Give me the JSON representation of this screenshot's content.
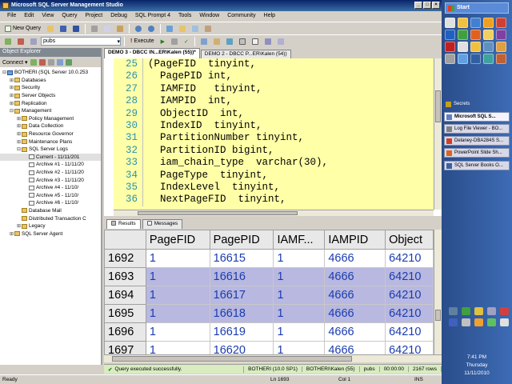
{
  "window": {
    "title": "Microsoft SQL Server Management Studio"
  },
  "menu": [
    "File",
    "Edit",
    "View",
    "Query",
    "Project",
    "Debug",
    "SQL Prompt 4",
    "Tools",
    "Window",
    "Community",
    "Help"
  ],
  "toolbar": {
    "new_query": "New Query",
    "database": "pubs",
    "execute": "Execute"
  },
  "object_explorer": {
    "title": "Object Explorer",
    "connect": "Connect ▾",
    "nodes": [
      {
        "label": "BOTHERI (SQL Server 10.0.253",
        "level": 0,
        "exp": "⊟",
        "kind": "srv"
      },
      {
        "label": "Databases",
        "level": 1,
        "exp": "⊞",
        "kind": "folder"
      },
      {
        "label": "Security",
        "level": 1,
        "exp": "⊞",
        "kind": "folder"
      },
      {
        "label": "Server Objects",
        "level": 1,
        "exp": "⊞",
        "kind": "folder"
      },
      {
        "label": "Replication",
        "level": 1,
        "exp": "⊞",
        "kind": "folder"
      },
      {
        "label": "Management",
        "level": 1,
        "exp": "⊟",
        "kind": "folder"
      },
      {
        "label": "Policy Management",
        "level": 2,
        "exp": "⊞",
        "kind": "folder"
      },
      {
        "label": "Data Collection",
        "level": 2,
        "exp": "⊞",
        "kind": "folder"
      },
      {
        "label": "Resource Governor",
        "level": 2,
        "exp": "⊞",
        "kind": "folder"
      },
      {
        "label": "Maintenance Plans",
        "level": 2,
        "exp": "⊞",
        "kind": "folder"
      },
      {
        "label": "SQL Server Logs",
        "level": 2,
        "exp": "⊟",
        "kind": "folder"
      },
      {
        "label": "Current - 11/11/201",
        "level": 3,
        "exp": "",
        "kind": "log",
        "selected": true
      },
      {
        "label": "Archive #1 - 11/11/20",
        "level": 3,
        "exp": "",
        "kind": "log"
      },
      {
        "label": "Archive #2 - 11/11/20",
        "level": 3,
        "exp": "",
        "kind": "log"
      },
      {
        "label": "Archive #3 - 11/11/20",
        "level": 3,
        "exp": "",
        "kind": "log"
      },
      {
        "label": "Archive #4 - 11/10/",
        "level": 3,
        "exp": "",
        "kind": "log"
      },
      {
        "label": "Archive #5 - 11/10/",
        "level": 3,
        "exp": "",
        "kind": "log"
      },
      {
        "label": "Archive #6 - 11/10/",
        "level": 3,
        "exp": "",
        "kind": "log"
      },
      {
        "label": "Database Mail",
        "level": 2,
        "exp": "",
        "kind": "folder"
      },
      {
        "label": "Distributed Transaction C",
        "level": 2,
        "exp": "",
        "kind": "folder"
      },
      {
        "label": "Legacy",
        "level": 2,
        "exp": "⊞",
        "kind": "folder"
      },
      {
        "label": "SQL Server Agent",
        "level": 1,
        "exp": "⊞",
        "kind": "folder"
      }
    ]
  },
  "editor_tabs": [
    {
      "label": "DEMO 3 - DBCC IN...ER\\Kalen (55))*",
      "active": true
    },
    {
      "label": "DEMO 2 - DBCC P...ER\\Kalen (54))",
      "active": false
    }
  ],
  "code_lines": [
    {
      "num": "25",
      "text": "(PageFID  tinyint,"
    },
    {
      "num": "26",
      "text": "  PagePID int,"
    },
    {
      "num": "27",
      "text": "  IAMFID   tinyint,"
    },
    {
      "num": "28",
      "text": "  IAMPID  int,"
    },
    {
      "num": "29",
      "text": "  ObjectID  int,"
    },
    {
      "num": "30",
      "text": "  IndexID  tinyint,"
    },
    {
      "num": "31",
      "text": "  PartitionNumber tinyint,"
    },
    {
      "num": "32",
      "text": "  PartitionID bigint,"
    },
    {
      "num": "33",
      "text": "  iam_chain_type  varchar(30),"
    },
    {
      "num": "34",
      "text": "  PageType  tinyint,"
    },
    {
      "num": "35",
      "text": "  IndexLevel  tinyint,"
    },
    {
      "num": "36",
      "text": "  NextPageFID  tinyint,"
    }
  ],
  "result_tabs": {
    "results": "Results",
    "messages": "Messages"
  },
  "grid": {
    "columns": [
      "PageFID",
      "PagePID",
      "IAMF...",
      "IAMPID",
      "Object"
    ],
    "rows": [
      {
        "rownum": "1692",
        "cells": [
          "1",
          "16615",
          "1",
          "4666",
          "64210"
        ],
        "hl": false
      },
      {
        "rownum": "1693",
        "cells": [
          "1",
          "16616",
          "1",
          "4666",
          "64210"
        ],
        "hl": true
      },
      {
        "rownum": "1694",
        "cells": [
          "1",
          "16617",
          "1",
          "4666",
          "64210"
        ],
        "hl": true
      },
      {
        "rownum": "1695",
        "cells": [
          "1",
          "16618",
          "1",
          "4666",
          "64210"
        ],
        "hl": true
      },
      {
        "rownum": "1696",
        "cells": [
          "1",
          "16619",
          "1",
          "4666",
          "64210"
        ],
        "hl": false
      },
      {
        "rownum": "1697",
        "cells": [
          "1",
          "16620",
          "1",
          "4666",
          "64210"
        ],
        "hl": false
      }
    ]
  },
  "query_status": {
    "message": "Query executed successfully.",
    "server": "BOTHERI (10.0 SP1)",
    "user": "BOTHERI\\Kalen (55)",
    "db": "pubs",
    "time": "00:00:00",
    "rows": "2167 rows"
  },
  "status": {
    "ready": "Ready",
    "ln": "Ln 1693",
    "col": "Col 1",
    "ins": "INS"
  },
  "taskbar": {
    "start": "Start",
    "tasks": [
      "Secrets",
      "Microsoft SQL S...",
      "Log File Viewer - BO...",
      "Delaney-DBA284S S...",
      "PowerPoint Slide Sh...",
      "SQL Server Books O..."
    ],
    "time": "7:41 PM",
    "day": "Thursday",
    "date": "11/11/2010"
  }
}
